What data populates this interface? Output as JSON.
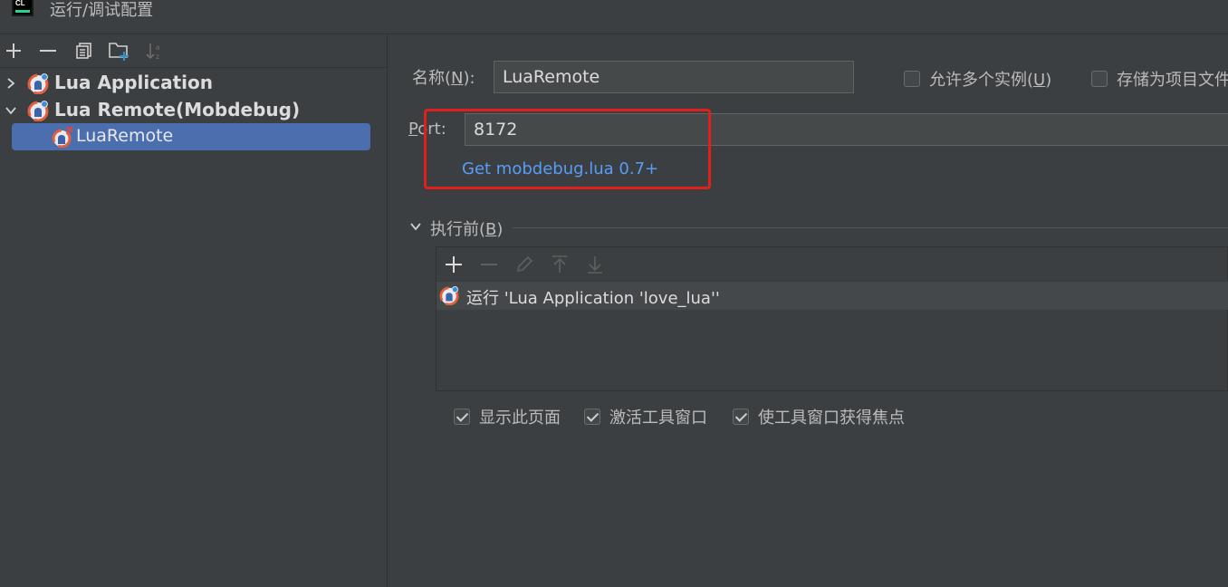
{
  "window": {
    "title": "运行/调试配置"
  },
  "left_toolbar": {
    "buttons": [
      "add-icon",
      "remove-icon",
      "copy-icon",
      "new-folder-icon",
      "sort-alphabetically-icon"
    ]
  },
  "tree": {
    "items": [
      {
        "label": "Lua Application",
        "expanded": false,
        "level": 0,
        "icon": "lua-icon"
      },
      {
        "label": "Lua Remote(Mobdebug)",
        "expanded": true,
        "level": 0,
        "icon": "lua-icon"
      },
      {
        "label": "LuaRemote",
        "selected": true,
        "level": 1,
        "icon": "lua-remote-error-icon"
      }
    ]
  },
  "form": {
    "name_label_prefix": "名称(",
    "name_label_mnemonic": "N",
    "name_label_suffix": "):",
    "name_value": "LuaRemote",
    "allow_multiple_prefix": "允许多个实例(",
    "allow_multiple_mnemonic": "U",
    "allow_multiple_suffix": ")",
    "allow_multiple_checked": false,
    "store_as_project_label": "存储为项目文件",
    "store_as_project_checked": false,
    "port_label_mnemonic": "P",
    "port_label_rest": "ort:",
    "port_value": "8172",
    "get_link": "Get mobdebug.lua 0.7+"
  },
  "before_launch": {
    "title_prefix": "执行前(",
    "title_mnemonic": "B",
    "title_suffix": ")",
    "toolbar": [
      "add-icon",
      "remove-icon",
      "edit-icon",
      "move-up-icon",
      "move-down-icon"
    ],
    "tasks": [
      {
        "label": "运行 'Lua Application 'love_lua''",
        "icon": "lua-icon"
      }
    ]
  },
  "options": [
    {
      "label": "显示此页面",
      "checked": true
    },
    {
      "label": "激活工具窗口",
      "checked": true
    },
    {
      "label": "使工具窗口获得焦点",
      "checked": true
    }
  ],
  "colors": {
    "background": "#3c3f41",
    "selection": "#4b6eaf",
    "link": "#589df6",
    "highlight_box": "#e0201c"
  }
}
